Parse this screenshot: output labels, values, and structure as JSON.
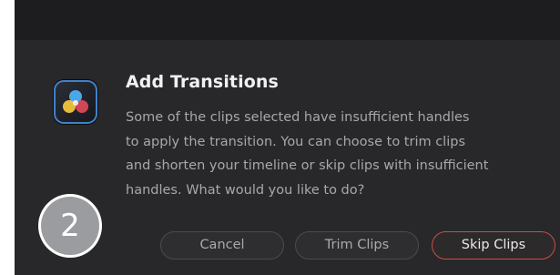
{
  "dialog": {
    "title": "Add Transitions",
    "message_lines": [
      "Some of the clips selected have insufficient handles",
      "to apply the transition. You can choose to trim clips",
      "and shorten your timeline or skip clips with insufficient",
      "handles. What would you like to do?"
    ],
    "buttons": {
      "cancel": "Cancel",
      "trim": "Trim Clips",
      "skip": "Skip Clips"
    },
    "icon": "davinci-resolve-app-icon",
    "accent_color": "#d04b3f"
  },
  "step_badge": "2"
}
